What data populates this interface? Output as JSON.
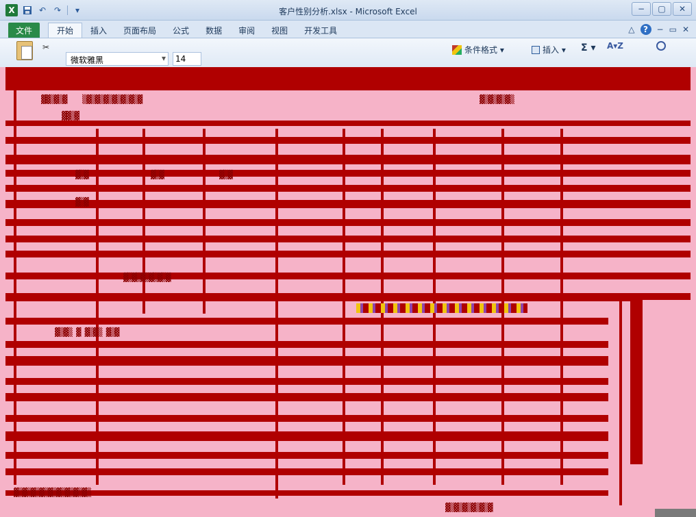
{
  "window": {
    "title": "客户性别分析.xlsx - Microsoft Excel",
    "app_icon": "X",
    "controls": {
      "minimize": "−",
      "maximize": "▢",
      "close": "✕"
    }
  },
  "quick_access": {
    "undo": "↶",
    "redo": "↷",
    "customize": "▾"
  },
  "tabs": {
    "file": "文件",
    "items": [
      "开始",
      "插入",
      "页面布局",
      "公式",
      "数据",
      "审阅",
      "视图",
      "开发工具"
    ],
    "active_index": 0,
    "right_icons": {
      "ribbon_toggle": "△",
      "help": "?",
      "min": "−",
      "restore": "▭",
      "close": "✕"
    }
  },
  "ribbon": {
    "font_name": "微软雅黑",
    "font_size": "14",
    "conditional_format": "条件格式 ▾",
    "insert": "插入 ▾",
    "sum": "Σ ▾",
    "sort_filter": "A▾Z"
  },
  "colors": {
    "corrupt_red": "#b00000",
    "corrupt_pink": "#f6b3c8",
    "file_tab_green": "#2a8a48"
  }
}
